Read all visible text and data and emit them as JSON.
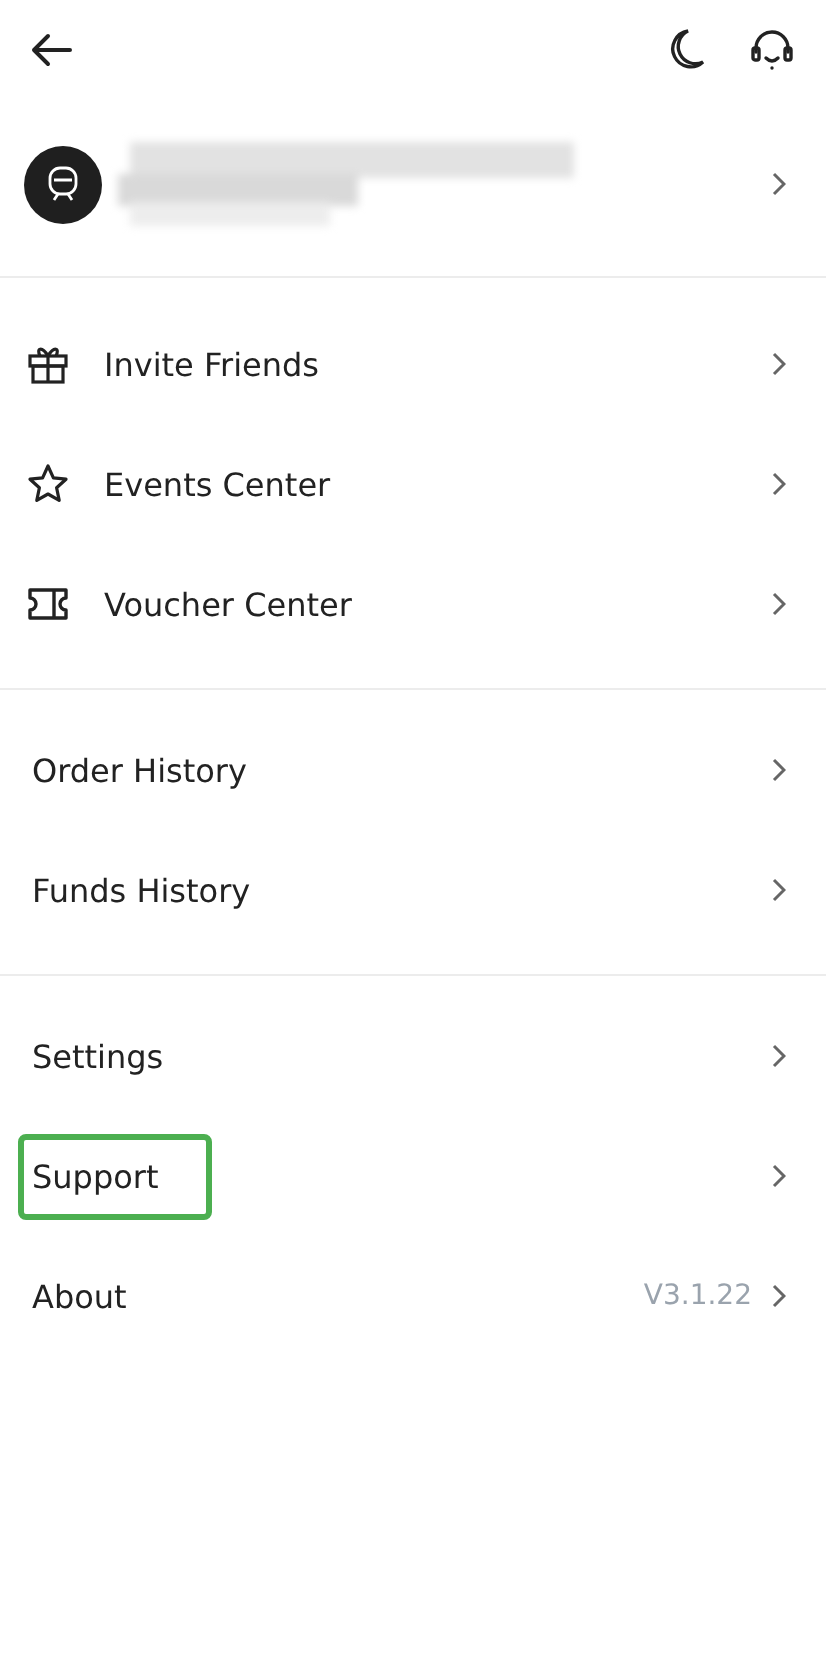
{
  "profile": {
    "name_redacted": true
  },
  "sections": [
    {
      "items": [
        {
          "label": "Invite Friends",
          "highlighted": false
        },
        {
          "label": "Events Center",
          "highlighted": false
        },
        {
          "label": "Voucher Center",
          "highlighted": false
        }
      ]
    },
    {
      "items": [
        {
          "label": "Order History",
          "highlighted": false
        },
        {
          "label": "Funds History",
          "highlighted": false
        }
      ]
    },
    {
      "items": [
        {
          "label": "Settings",
          "highlighted": false
        },
        {
          "label": "Support",
          "highlighted": true
        },
        {
          "label": "About",
          "highlighted": false,
          "value": "V3.1.22"
        }
      ]
    }
  ]
}
